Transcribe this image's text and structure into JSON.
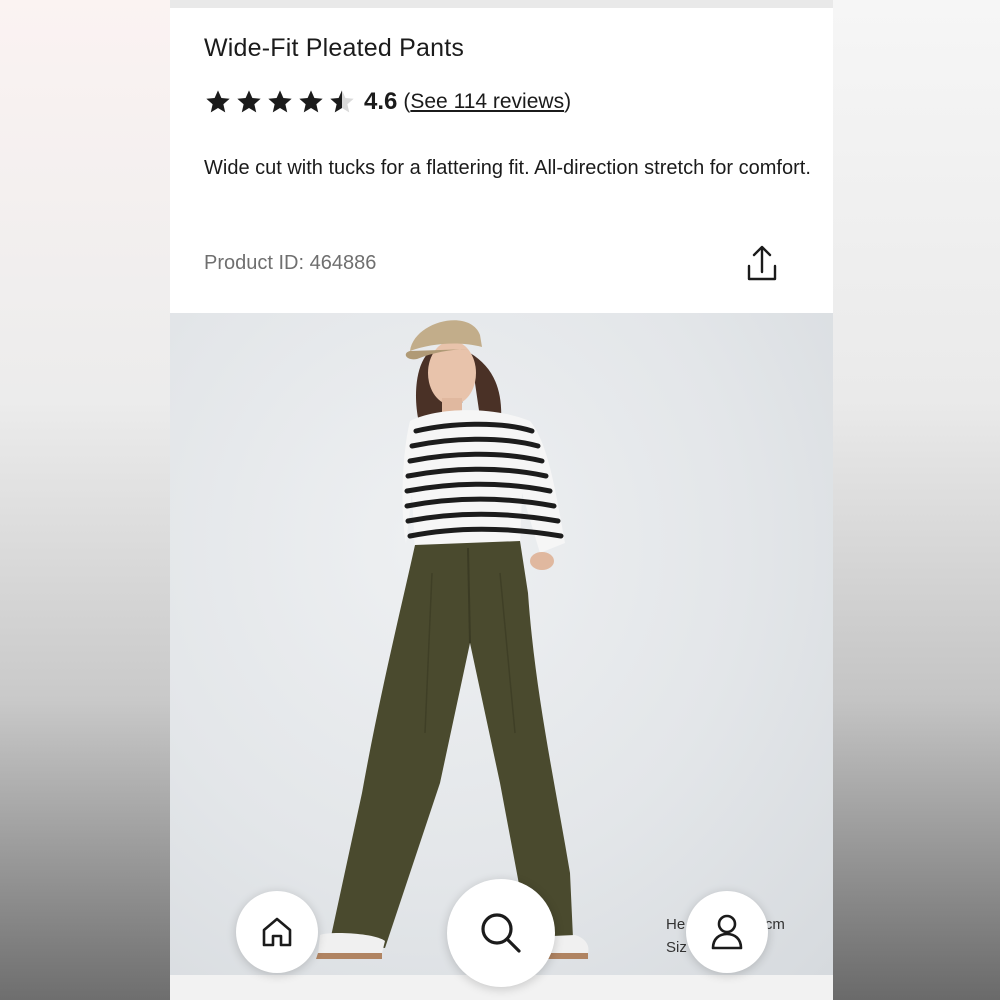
{
  "product": {
    "title": "Wide-Fit Pleated Pants",
    "rating": "4.6",
    "rating_stars": 4.5,
    "reviews_open": "(",
    "reviews_link": "See 114 reviews",
    "reviews_close": ")",
    "description": "Wide cut with tucks for a flattering fit. All-direction stretch for comfort.",
    "product_id": "Product ID: 464886",
    "share_icon": "share-icon"
  },
  "photo": {
    "model_info_line1": "He",
    "model_info_line1_end": "70cm",
    "model_info_line2": "Siz"
  },
  "bottom_nav": {
    "items": [
      {
        "icon": "home-icon"
      },
      {
        "icon": "search-icon"
      },
      {
        "icon": "account-icon"
      }
    ]
  },
  "colors": {
    "text": "#1b1b1b",
    "muted": "#6f6f6f",
    "pants": "#4a4a2e",
    "cap": "#c2ad8a"
  }
}
